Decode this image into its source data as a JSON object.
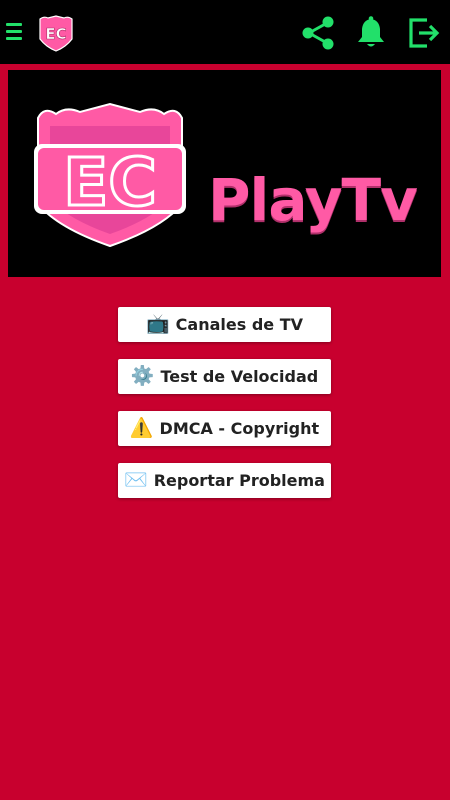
{
  "header": {
    "menu_icon": "hamburger-icon",
    "logo_icon": "ec-shield-logo",
    "actions": [
      "share-icon",
      "bell-icon",
      "exit-icon"
    ]
  },
  "banner": {
    "logo_text": "EC",
    "title": "PlayTv"
  },
  "buttons": [
    {
      "emoji": "📺",
      "icon": "tv-icon",
      "label": "Canales de TV"
    },
    {
      "emoji": "⚙️",
      "icon": "gear-icon",
      "label": "Test de Velocidad"
    },
    {
      "emoji": "⚠️",
      "icon": "warning-icon",
      "label": "DMCA - Copyright"
    },
    {
      "emoji": "✉️",
      "icon": "envelope-icon",
      "label": "Reportar Problema"
    }
  ],
  "colors": {
    "background": "#c8002e",
    "topbar": "#000000",
    "accent_green": "#22e06a",
    "brand_pink": "#ff5aa5"
  }
}
